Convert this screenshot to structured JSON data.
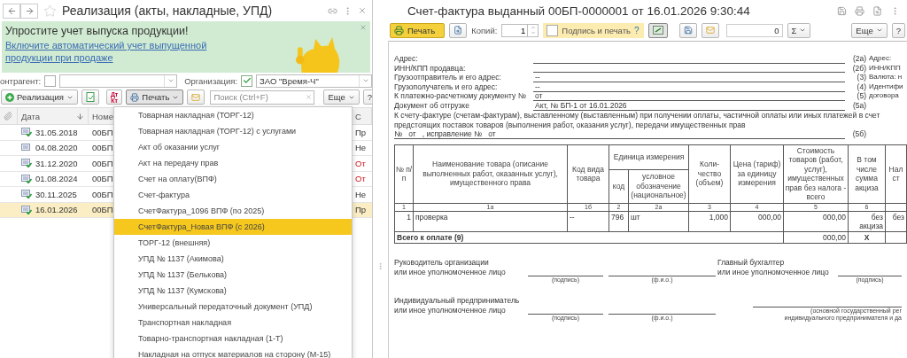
{
  "list_window": {
    "title": "Реализация (акты, накладные, УПД)",
    "banner": {
      "title": "Упростите учет выпуска продукции!",
      "link": "Включите автоматический учет выпущенной\nпродукции при продаже"
    },
    "filters": [
      {
        "label": "онтрагент:",
        "checked": false
      },
      {
        "label": "Организация:",
        "checked": true,
        "value": "ЗАО \"Время-Ч\""
      }
    ],
    "toolbar": {
      "create": "Реализация",
      "dtkt": [
        "Дт",
        "Кт"
      ],
      "print": "Печать",
      "search_placeholder": "Поиск (Ctrl+F)",
      "more": "Еще",
      "help": "?"
    },
    "table": {
      "columns": [
        "Дата",
        "Номе",
        "С"
      ],
      "rows": [
        {
          "date": "31.05.2018",
          "number": "00БП",
          "status": "Пр",
          "flagged": false,
          "posted": true,
          "selected": false
        },
        {
          "date": "04.08.2020",
          "number": "00БП",
          "status": "Не",
          "flagged": false,
          "posted": false,
          "selected": false
        },
        {
          "date": "31.12.2020",
          "number": "00БП",
          "status": "От",
          "flagged": true,
          "posted": true,
          "selected": false
        },
        {
          "date": "01.08.2024",
          "number": "00БП",
          "status": "От",
          "flagged": true,
          "posted": true,
          "selected": false
        },
        {
          "date": "30.11.2025",
          "number": "00БП",
          "status": "Не",
          "flagged": false,
          "posted": true,
          "selected": false
        },
        {
          "date": "16.01.2026",
          "number": "00БП",
          "status": "Пр",
          "flagged": false,
          "posted": true,
          "selected": true
        }
      ]
    },
    "print_menu": [
      {
        "label": "Товарная накладная (ТОРГ-12)",
        "selected": false
      },
      {
        "label": "Товарная накладная (ТОРГ-12) с услугами",
        "selected": false
      },
      {
        "label": "Акт об оказании услуг",
        "selected": false
      },
      {
        "label": "Акт на передачу прав",
        "selected": false
      },
      {
        "label": "Счет на оплату(ВПФ)",
        "selected": false
      },
      {
        "label": "Счет-фактура",
        "selected": false
      },
      {
        "label": "СчетФактура_1096 ВПФ (по 2025)",
        "selected": false
      },
      {
        "label": "СчетФактура_Новая ВПФ (с 2026)",
        "selected": true
      },
      {
        "label": "ТОРГ-12 (внешняя)",
        "selected": false
      },
      {
        "label": "УПД № 1137 (Акимова)",
        "selected": false
      },
      {
        "label": "УПД № 1137 (Белькова)",
        "selected": false
      },
      {
        "label": "УПД № 1137 (Кумскова)",
        "selected": false
      },
      {
        "label": "Универсальный передаточный документ (УПД)",
        "selected": false
      },
      {
        "label": "Транспортная накладная",
        "selected": false
      },
      {
        "label": "Товарно-транспортная накладная (1-Т)",
        "selected": false
      },
      {
        "label": "Накладная на отпуск материалов на сторону (М-15)",
        "selected": false
      }
    ]
  },
  "document_window": {
    "title": "Счет-фактура выданный 00БП-0000001 от 16.01.2026 9:30:44",
    "toolbar": {
      "print": "Печать",
      "copies_label": "Копий:",
      "copies": "1",
      "sign_label": "Подпись и печать",
      "sign_checked": false,
      "sign_help": "?",
      "sum": "0",
      "sigma": "Σ",
      "more": "Еще",
      "help": "?"
    },
    "invoice": {
      "fields": [
        {
          "label": "Адрес:",
          "code": "(2а)",
          "side": "Адрес:"
        },
        {
          "label": "ИНН/КПП продавца:",
          "code": "(2б)",
          "side": "ИНН/КПП"
        },
        {
          "label": "Грузоотправитель и его адрес:",
          "value": "--",
          "code": "(3)",
          "side": "Валюта: н"
        },
        {
          "label": "Грузополучатель и его адрес:",
          "value": "--",
          "code": "(4)",
          "side": "Идентифи"
        },
        {
          "label": "К платежно-расчетному документу №",
          "value": "от",
          "code": "(5)",
          "side": "договора"
        },
        {
          "label": "Документ об отгрузке",
          "value": "Акт, № БП-1 от 16.01.2026",
          "code": "(5а)"
        }
      ],
      "advance_note": "К счету-фактуре (счетам-фактурам), выставленному (выставленным) при получении оплаты, частичной оплаты или иных платежей в счет\nпредстоящих поставок товаров (выполнения работ, оказания услуг), передачи имущественных прав",
      "correction": {
        "text": "№   от   , исправление №   от",
        "code": "(5б)"
      },
      "table": {
        "unit_group": "Единица измерения",
        "columns": [
          {
            "label": "№ п/п",
            "number": "1",
            "kind": "main"
          },
          {
            "label": "Наименование товара (описание выполненных работ, оказанных услуг), имущественного права",
            "number": "1а",
            "kind": "main"
          },
          {
            "label": "Код вида товара",
            "number": "1б",
            "kind": "main"
          },
          {
            "label": "код",
            "number": "2",
            "kind": "sub"
          },
          {
            "label": "условное обозначение (национальное)",
            "number": "2а",
            "kind": "sub"
          },
          {
            "label": "Коли-чество (объем)",
            "number": "3",
            "kind": "main"
          },
          {
            "label": "Цена (тариф) за единицу измерения",
            "number": "4",
            "kind": "main"
          },
          {
            "label": "Стоимость товаров (работ, услуг), имущественных прав без налога - всего",
            "number": "5",
            "kind": "main"
          },
          {
            "label": "В том числе сумма акциза",
            "number": "6",
            "kind": "main"
          },
          {
            "label": "Нал ст",
            "kind": "main"
          }
        ],
        "rows": [
          {
            "cells": [
              "1",
              "проверка",
              "--",
              "796",
              "шт",
              "1,000",
              "000,00",
              "000,00",
              "без акциза",
              "без"
            ]
          }
        ],
        "total": {
          "label": "Всего к оплате (9)",
          "amount": "000,00",
          "excise": "X"
        }
      },
      "signatures": [
        {
          "role": "Руководитель организации\nили иное уполномоченное лицо",
          "captions": [
            "(подпись)",
            "(ф.и.о.)"
          ]
        },
        {
          "role": "Главный бухгалтер\nили иное уполномоченное лицо",
          "captions": [
            "(подпись)"
          ]
        },
        {
          "role": "Индивидуальный предприниматель\nили иное уполномоченное лицо",
          "captions": [
            "(подпись)",
            "(ф.и.о.)"
          ]
        }
      ],
      "registration_caption": "(основной государственный рег\nиндивидуального предпринимателя и да"
    }
  }
}
